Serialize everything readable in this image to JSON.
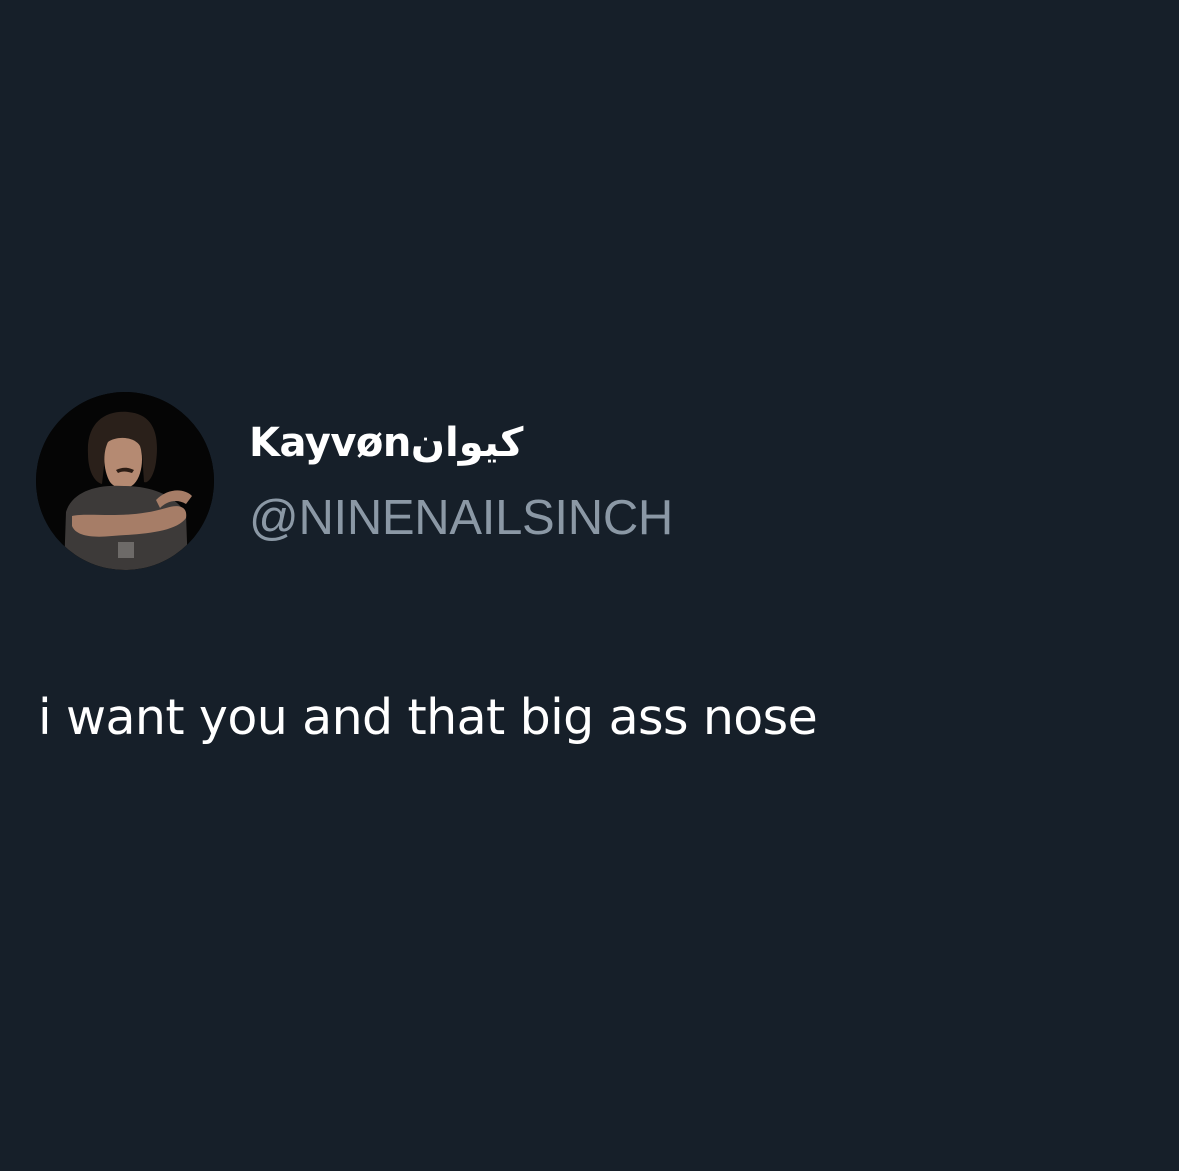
{
  "tweet": {
    "author": {
      "display_name": "Kayvønکیوان",
      "handle": "@NINENAILSINCH",
      "avatar": "profile-photo"
    },
    "text": "i want you and that big ass nose"
  },
  "colors": {
    "background": "#161f29",
    "name": "#ffffff",
    "handle": "#8b98a5",
    "text": "#ffffff"
  }
}
